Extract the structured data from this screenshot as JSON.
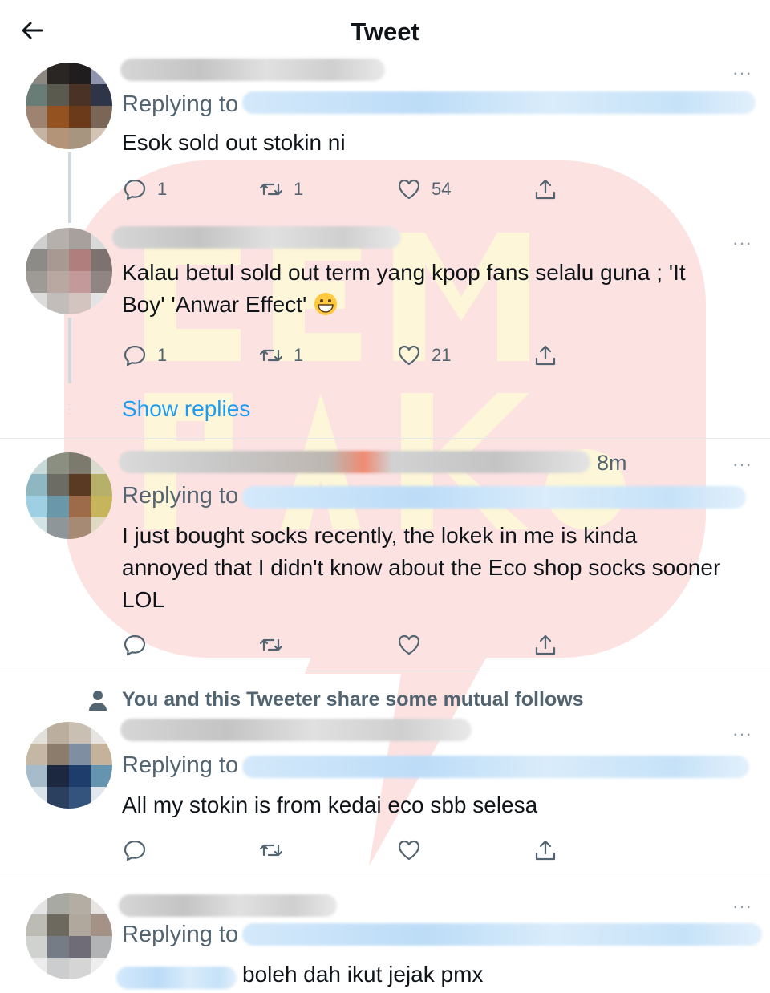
{
  "header": {
    "title": "Tweet",
    "back_icon": "back-arrow-icon"
  },
  "replying_label": "Replying to",
  "show_replies": "Show replies",
  "mutual_note": "You and this Tweeter share some mutual follows",
  "tweets": [
    {
      "text": "Esok sold out stokin ni",
      "replies": "1",
      "retweets": "1",
      "likes": "54"
    },
    {
      "text": "Kalau betul sold out term yang kpop fans selalu guna ; 'It Boy'  'Anwar Effect' ",
      "emoji": "grinning-face-emoji",
      "replies": "1",
      "retweets": "1",
      "likes": "21"
    },
    {
      "time": "8m",
      "text": "I just bought socks recently, the lokek in me is kinda annoyed that I didn't know about the Eco shop socks sooner LOL",
      "replies": "",
      "retweets": "",
      "likes": ""
    },
    {
      "text": "All my stokin is from kedai eco sbb selesa",
      "replies": "",
      "retweets": "",
      "likes": ""
    },
    {
      "text": "boleh dah ikut jejak pmx"
    }
  ],
  "colors": {
    "link": "#1d9bf0",
    "secondary": "#536471",
    "text": "#0f1419",
    "thread_line": "#cfd9de"
  }
}
